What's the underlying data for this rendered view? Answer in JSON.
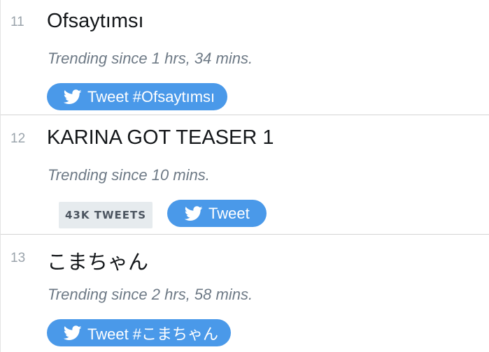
{
  "trends": [
    {
      "rank": "11",
      "name": "Ofsaytımsı",
      "since": "Trending since 1 hrs, 34 mins.",
      "tweet_label": "Tweet #Ofsaytımsı"
    },
    {
      "rank": "12",
      "name": "KARINA GOT TEASER 1",
      "since": "Trending since 10 mins.",
      "count_badge": "43K TWEETS",
      "tweet_label": "Tweet"
    },
    {
      "rank": "13",
      "name": "こまちゃん",
      "since": "Trending since 2 hrs, 58 mins.",
      "tweet_label": "Tweet #こまちゃん"
    }
  ],
  "colors": {
    "tweet_button_bg": "#4a99e9",
    "badge_bg": "#e6ebee",
    "since_text": "#6e7a86",
    "rank_text": "#9aa3ab"
  },
  "icons": {
    "tweet_button": "twitter-bird-icon"
  }
}
